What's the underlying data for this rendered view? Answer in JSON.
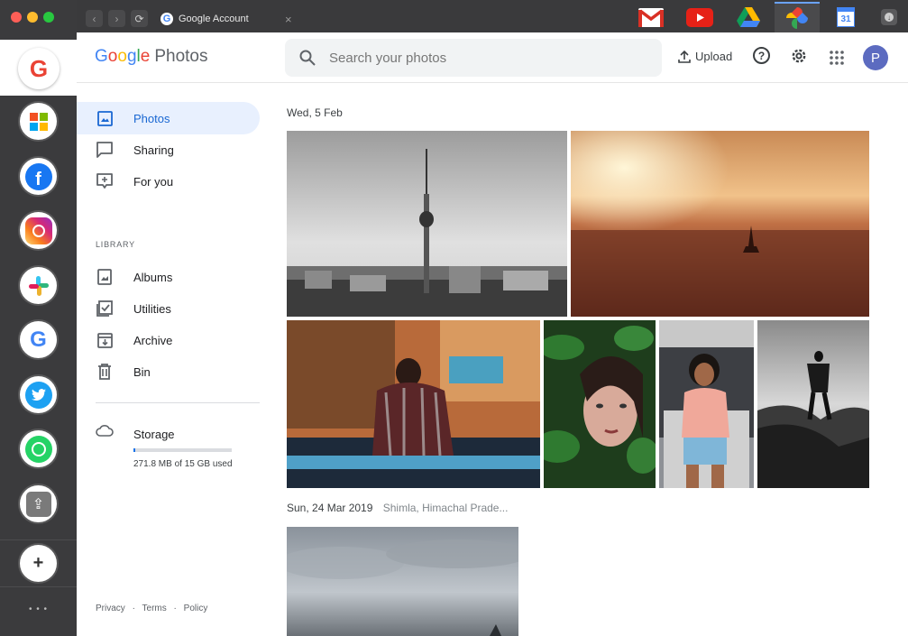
{
  "tab": {
    "title": "Google Account"
  },
  "header": {
    "logo_word": "Google",
    "logo_product": "Photos",
    "search_placeholder": "Search your photos",
    "upload_label": "Upload",
    "avatar_letter": "P"
  },
  "sidebar": {
    "items": [
      {
        "label": "Photos",
        "icon": "photo-icon"
      },
      {
        "label": "Sharing",
        "icon": "chat-icon"
      },
      {
        "label": "For you",
        "icon": "sparkle-icon"
      }
    ],
    "library_heading": "LIBRARY",
    "library_items": [
      {
        "label": "Albums",
        "icon": "album-icon"
      },
      {
        "label": "Utilities",
        "icon": "checkbox-icon"
      },
      {
        "label": "Archive",
        "icon": "archive-icon"
      },
      {
        "label": "Bin",
        "icon": "trash-icon"
      }
    ],
    "storage": {
      "label": "Storage",
      "usage": "271.8 MB of 15 GB used",
      "fraction": 0.018
    },
    "footer": [
      "Privacy",
      "Terms",
      "Policy"
    ]
  },
  "content": {
    "groups": [
      {
        "date": "Wed, 5 Feb",
        "location": ""
      },
      {
        "date": "Sun, 24 Mar 2019",
        "location": "Shimla, Himachal Prade..."
      }
    ]
  },
  "dock": {
    "apps": [
      "google-app",
      "microsoft-app",
      "facebook-app",
      "instagram-app",
      "slack-app",
      "google-search-app",
      "twitter-app",
      "whatsapp-app",
      "upload-app"
    ],
    "add_label": "+",
    "more_label": "• • •"
  },
  "colors": {
    "accent": "#1a73e8",
    "active_bg": "#e8f0fe",
    "avatar": "#5c6bc0"
  }
}
